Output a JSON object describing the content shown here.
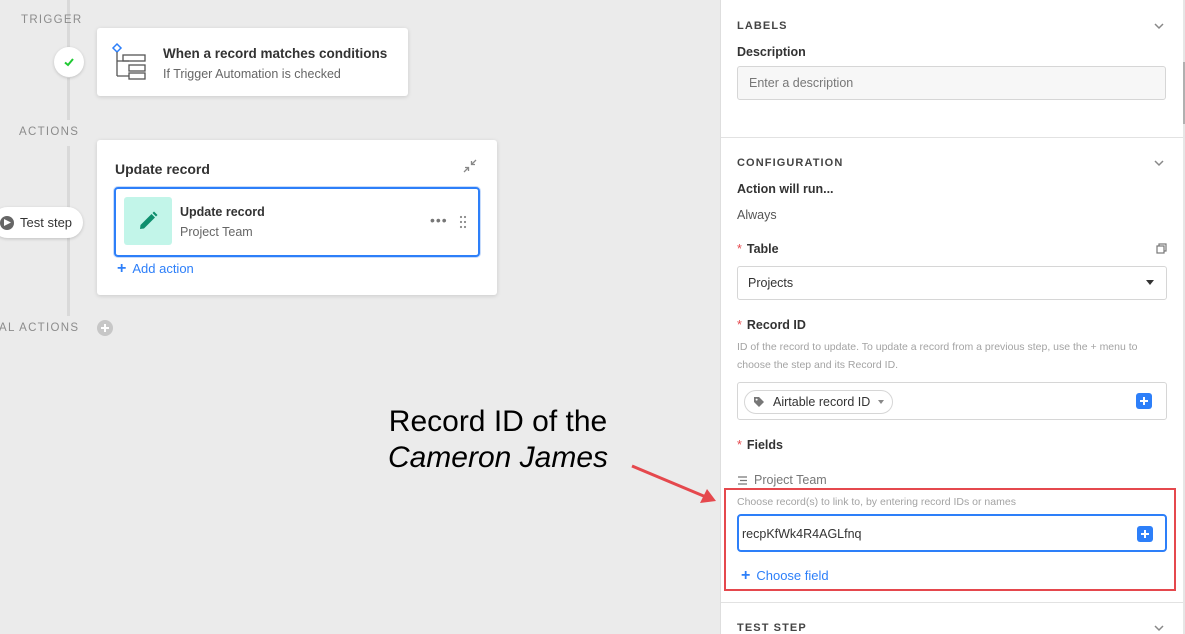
{
  "canvas": {
    "trigger_label": "TRIGGER",
    "actions_label": "ACTIONS",
    "conditional_label": "AL ACTIONS",
    "trigger_card": {
      "title": "When a record matches conditions",
      "subtitle": "If Trigger Automation is checked"
    },
    "test_step_label": "Test step",
    "action_card": {
      "title": "Update record",
      "inner_title": "Update record",
      "inner_subtitle": "Project Team",
      "more": "•••",
      "add_action_label": "Add action"
    }
  },
  "annotation": {
    "line1": "Record ID of the",
    "line2": "Cameron James"
  },
  "panel": {
    "labels_section": {
      "header": "LABELS",
      "description_label": "Description",
      "description_placeholder": "Enter a description"
    },
    "configuration_section": {
      "header": "CONFIGURATION",
      "action_will_run_label": "Action will run...",
      "action_will_run_value": "Always",
      "table_label": "Table",
      "table_value": "Projects",
      "record_id_label": "Record ID",
      "record_id_help": "ID of the record to update. To update a record from a previous step, use the + menu to choose the step and its Record ID.",
      "record_id_token": "Airtable record ID",
      "fields_label": "Fields",
      "field_name": "Project Team",
      "field_help": "Choose record(s) to link to, by entering record IDs or names",
      "field_value": "recpKfWk4R4AGLfnq",
      "choose_field_label": "Choose field",
      "required_mark": "*"
    },
    "test_step_section": {
      "header": "TEST STEP"
    }
  },
  "colors": {
    "accent": "#2d7ff9",
    "success": "#20c933",
    "highlight": "#e5484d",
    "pencil_bg": "#c2f5e9",
    "pencil": "#0e8f6e"
  }
}
